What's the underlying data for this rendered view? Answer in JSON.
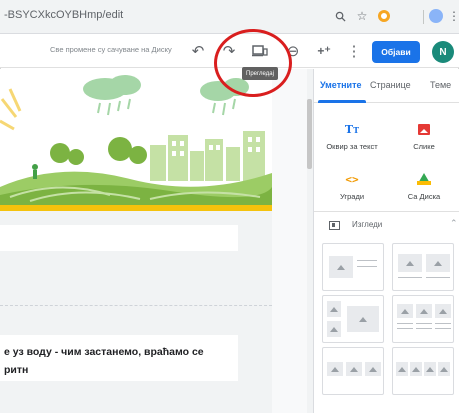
{
  "browser": {
    "url": "-BSYCXkcOYBHmp/edit",
    "icons": [
      "zoom-icon",
      "bookmark-star-icon",
      "extension-icon",
      "extension-2-icon",
      "menu-kebab-icon"
    ]
  },
  "toolbar": {
    "saved_status": "Све промене су сачуване на Диску",
    "undo_icon": "↶",
    "redo_icon": "↷",
    "preview_icon": "▭",
    "link_icon": "⊖",
    "share_icon": "+⁺",
    "more_icon": "⋮",
    "publish_label": "Објави",
    "avatar_initial": "N",
    "tooltip": "Прегледај"
  },
  "canvas": {
    "body_text_line1": "е уз воду - чим застанемо, враћамо се",
    "body_text_line2": "ритн"
  },
  "panel": {
    "tabs": [
      "Уметните",
      "Странице",
      "Теме"
    ],
    "insert_items": [
      {
        "label": "Оквир за текст",
        "icon": "text-box-icon"
      },
      {
        "label": "Слике",
        "icon": "images-icon"
      },
      {
        "label": "Угради",
        "icon": "embed-icon"
      },
      {
        "label": "Са Диска",
        "icon": "drive-icon"
      }
    ],
    "layouts_label": "Изгледи"
  },
  "colors": {
    "accent": "#1a73e8",
    "highlight": "#d91e1e",
    "hero_bar": "#f4c20d"
  }
}
